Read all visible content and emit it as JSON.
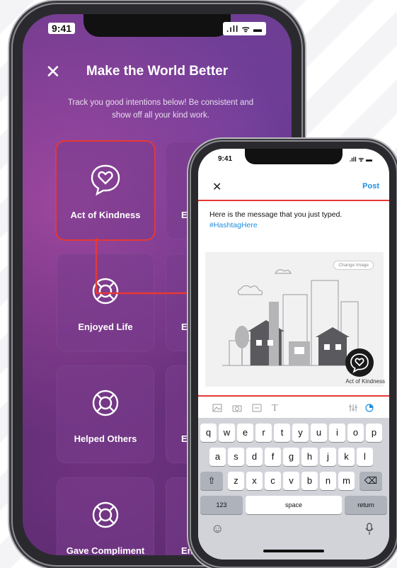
{
  "status": {
    "time": "9:41",
    "icons": ".ıll ᯤ ▬"
  },
  "back_app": {
    "title": "Make the World Better",
    "subtitle": "Track you good intentions below! Be consistent and show off all your kind work.",
    "close_glyph": "✕",
    "tiles_left": [
      {
        "label": "Act of Kindness",
        "icon": "heart-bubble-icon"
      },
      {
        "label": "Enjoyed Life",
        "icon": "lifebuoy-icon"
      },
      {
        "label": "Helped Others",
        "icon": "lifebuoy-icon"
      },
      {
        "label": "Gave Compliment",
        "icon": "lifebuoy-icon"
      }
    ],
    "tiles_right": [
      "Ej",
      "Enj",
      "Enj",
      "Enj"
    ]
  },
  "front_app": {
    "close_glyph": "✕",
    "post_label": "Post",
    "message": "Here is the message that you just typed.",
    "hashtag": "#HashtagHere",
    "change_image_label": "Change Image",
    "badge_label": "Act of Kindness",
    "toolbar_icons": [
      "image-icon",
      "camera-icon",
      "gif-icon",
      "text-icon",
      "settings-icon",
      "circle-icon"
    ],
    "text_tool_glyph": "T"
  },
  "keyboard": {
    "row1": [
      "q",
      "w",
      "e",
      "r",
      "t",
      "y",
      "u",
      "i",
      "o",
      "p"
    ],
    "row2": [
      "a",
      "s",
      "d",
      "f",
      "g",
      "h",
      "j",
      "k",
      "l"
    ],
    "row3": [
      "z",
      "x",
      "c",
      "v",
      "b",
      "n",
      "m"
    ],
    "shift": "⇧",
    "backspace": "⌫",
    "num_label": "123",
    "space_label": "space",
    "return_label": "return",
    "emoji": "☺",
    "mic": "🎙"
  },
  "colors": {
    "highlight": "#e53935",
    "link": "#1d8fe1",
    "app_bg": "#5a2f78"
  }
}
